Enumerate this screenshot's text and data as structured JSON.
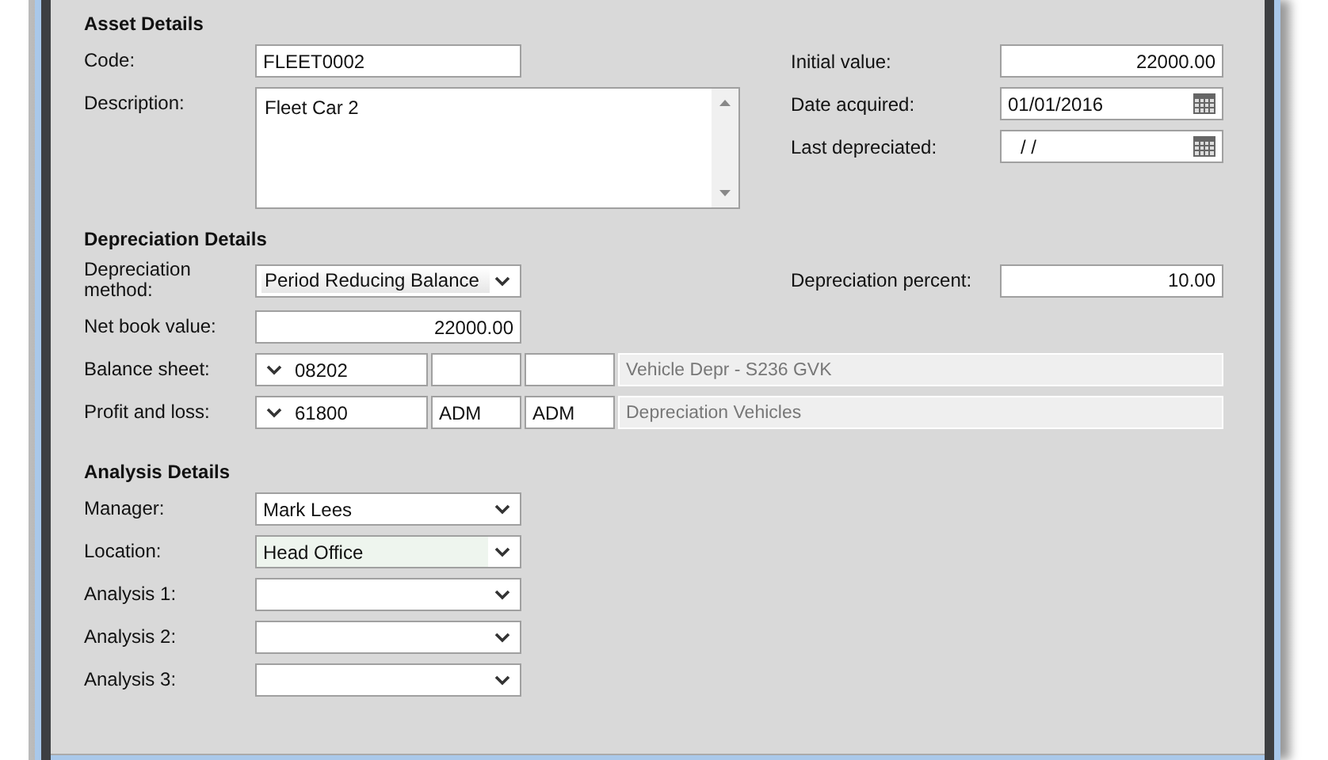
{
  "asset_details": {
    "title": "Asset Details",
    "left": [
      {
        "label": "Code:",
        "kind": "text",
        "value": "FLEET0002"
      },
      {
        "label": "Description:",
        "kind": "textarea",
        "value": "Fleet Car 2"
      }
    ],
    "right": [
      {
        "label": "Initial value:",
        "kind": "number",
        "value": "22000.00"
      },
      {
        "label": "Date acquired:",
        "kind": "date",
        "value": "01/01/2016"
      },
      {
        "label": "Last depreciated:",
        "kind": "date",
        "value": "/ /"
      }
    ]
  },
  "depreciation_details": {
    "title": "Depreciation Details",
    "method": {
      "label": "Depreciation method:",
      "value": "Period Reducing Balance"
    },
    "percent": {
      "label": "Depreciation percent:",
      "value": "10.00"
    },
    "net_book_value": {
      "label": "Net book value:",
      "value": "22000.00"
    },
    "ledgers": [
      {
        "label": "Balance sheet:",
        "account": "08202",
        "description": "Vehicle Depr - S236 GVK"
      },
      {
        "label": "Profit and loss:",
        "account": "61800",
        "field_2": "ADM",
        "field_3": "ADM",
        "description": "Depreciation Vehicles"
      }
    ]
  },
  "analysis_details": {
    "title": "Analysis Details",
    "rows": [
      {
        "label": "Manager:",
        "value": "Mark Lees",
        "focused": false
      },
      {
        "label": "Location:",
        "value": "Head Office",
        "focused": true
      },
      {
        "label": "Analysis 1:",
        "focused": false
      },
      {
        "label": "Analysis 2:",
        "focused": false
      },
      {
        "label": "Analysis 3:",
        "focused": false
      }
    ]
  }
}
